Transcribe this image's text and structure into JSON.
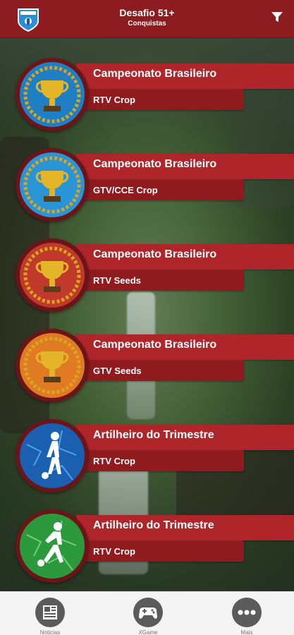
{
  "header": {
    "title": "Desafio 51+",
    "subtitle": "Conquistas"
  },
  "icons": {
    "logo": "shield-logo",
    "filter": "filter-icon"
  },
  "achievements": [
    {
      "title": "Campeonato Brasileiro",
      "category": "RTV Crop",
      "badge": "trophy-blue"
    },
    {
      "title": "Campeonato Brasileiro",
      "category": "GTV/CCE Crop",
      "badge": "trophy-blue"
    },
    {
      "title": "Campeonato Brasileiro",
      "category": "RTV Seeds",
      "badge": "trophy-red"
    },
    {
      "title": "Campeonato Brasileiro",
      "category": "GTV Seeds",
      "badge": "trophy-orange"
    },
    {
      "title": "Artilheiro do Trimestre",
      "category": "RTV Crop",
      "badge": "player-blue"
    },
    {
      "title": "Artilheiro do Trimestre",
      "category": "RTV Crop",
      "badge": "player-green"
    }
  ],
  "tabs": [
    {
      "label": "Noticias",
      "icon": "newspaper-icon"
    },
    {
      "label": "XGame",
      "icon": "gamepad-icon"
    },
    {
      "label": "Mais",
      "icon": "more-icon"
    }
  ],
  "colors": {
    "header": "#8c1c1f",
    "title_bar": "#b0252a",
    "sub_bar": "#8f1b1f",
    "medal_blue": "#1f7fc4",
    "medal_red": "#c0392b",
    "medal_orange": "#e07b24",
    "medal_green": "#2c9a3c",
    "gold": "#d9a521"
  }
}
